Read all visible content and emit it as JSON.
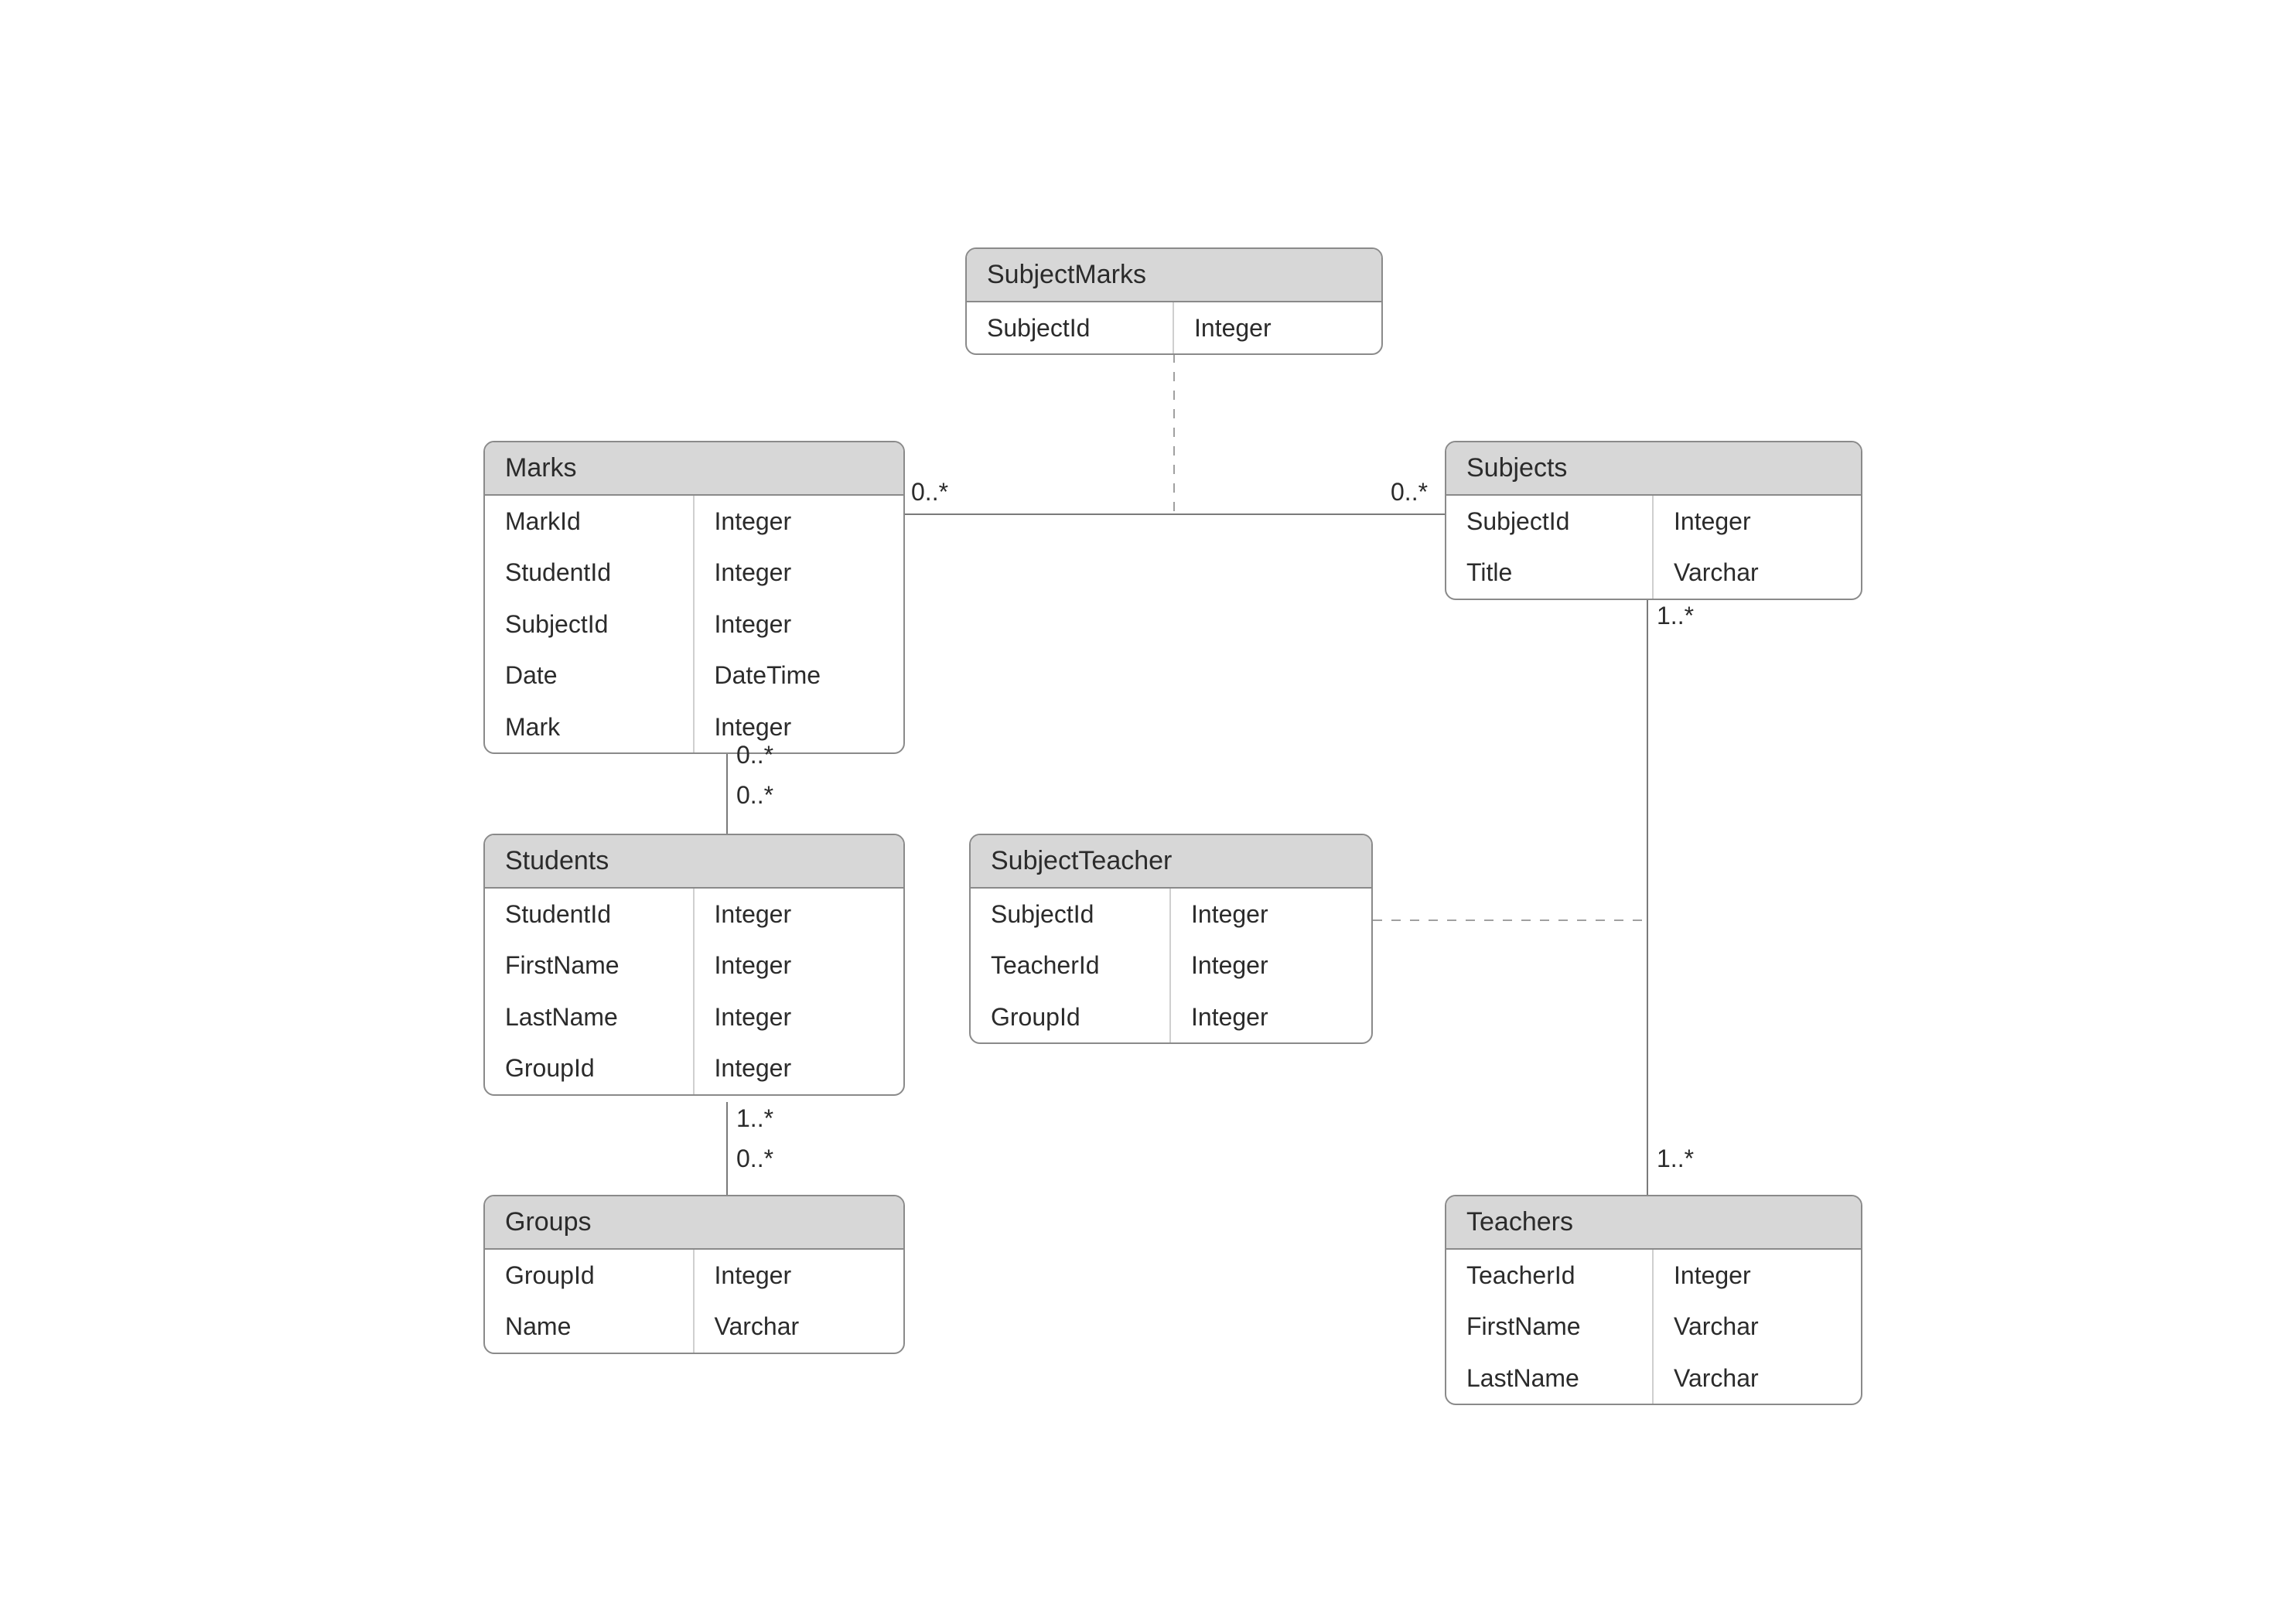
{
  "entities": {
    "subjectMarks": {
      "title": "SubjectMarks",
      "rows": [
        {
          "name": "SubjectId",
          "type": "Integer"
        }
      ]
    },
    "marks": {
      "title": "Marks",
      "rows": [
        {
          "name": "MarkId",
          "type": "Integer"
        },
        {
          "name": "StudentId",
          "type": "Integer"
        },
        {
          "name": "SubjectId",
          "type": "Integer"
        },
        {
          "name": "Date",
          "type": "DateTime"
        },
        {
          "name": "Mark",
          "type": "Integer"
        }
      ]
    },
    "subjects": {
      "title": "Subjects",
      "rows": [
        {
          "name": "SubjectId",
          "type": "Integer"
        },
        {
          "name": "Title",
          "type": "Varchar"
        }
      ]
    },
    "students": {
      "title": "Students",
      "rows": [
        {
          "name": "StudentId",
          "type": "Integer"
        },
        {
          "name": "FirstName",
          "type": "Integer"
        },
        {
          "name": "LastName",
          "type": "Integer"
        },
        {
          "name": "GroupId",
          "type": "Integer"
        }
      ]
    },
    "subjectTeacher": {
      "title": "SubjectTeacher",
      "rows": [
        {
          "name": "SubjectId",
          "type": "Integer"
        },
        {
          "name": "TeacherId",
          "type": "Integer"
        },
        {
          "name": "GroupId",
          "type": "Integer"
        }
      ]
    },
    "groups": {
      "title": "Groups",
      "rows": [
        {
          "name": "GroupId",
          "type": "Integer"
        },
        {
          "name": "Name",
          "type": "Varchar"
        }
      ]
    },
    "teachers": {
      "title": "Teachers",
      "rows": [
        {
          "name": "TeacherId",
          "type": "Integer"
        },
        {
          "name": "FirstName",
          "type": "Varchar"
        },
        {
          "name": "LastName",
          "type": "Varchar"
        }
      ]
    }
  },
  "multiplicities": {
    "marks_to_subjects_left": "0..*",
    "marks_to_subjects_right": "0..*",
    "marks_to_students_top": "0..*",
    "marks_to_students_bottom": "0..*",
    "students_to_groups_top": "1..*",
    "students_to_groups_bottom": "0..*",
    "subjects_to_teachers_top": "1..*",
    "subjects_to_teachers_bot": "1..*"
  }
}
